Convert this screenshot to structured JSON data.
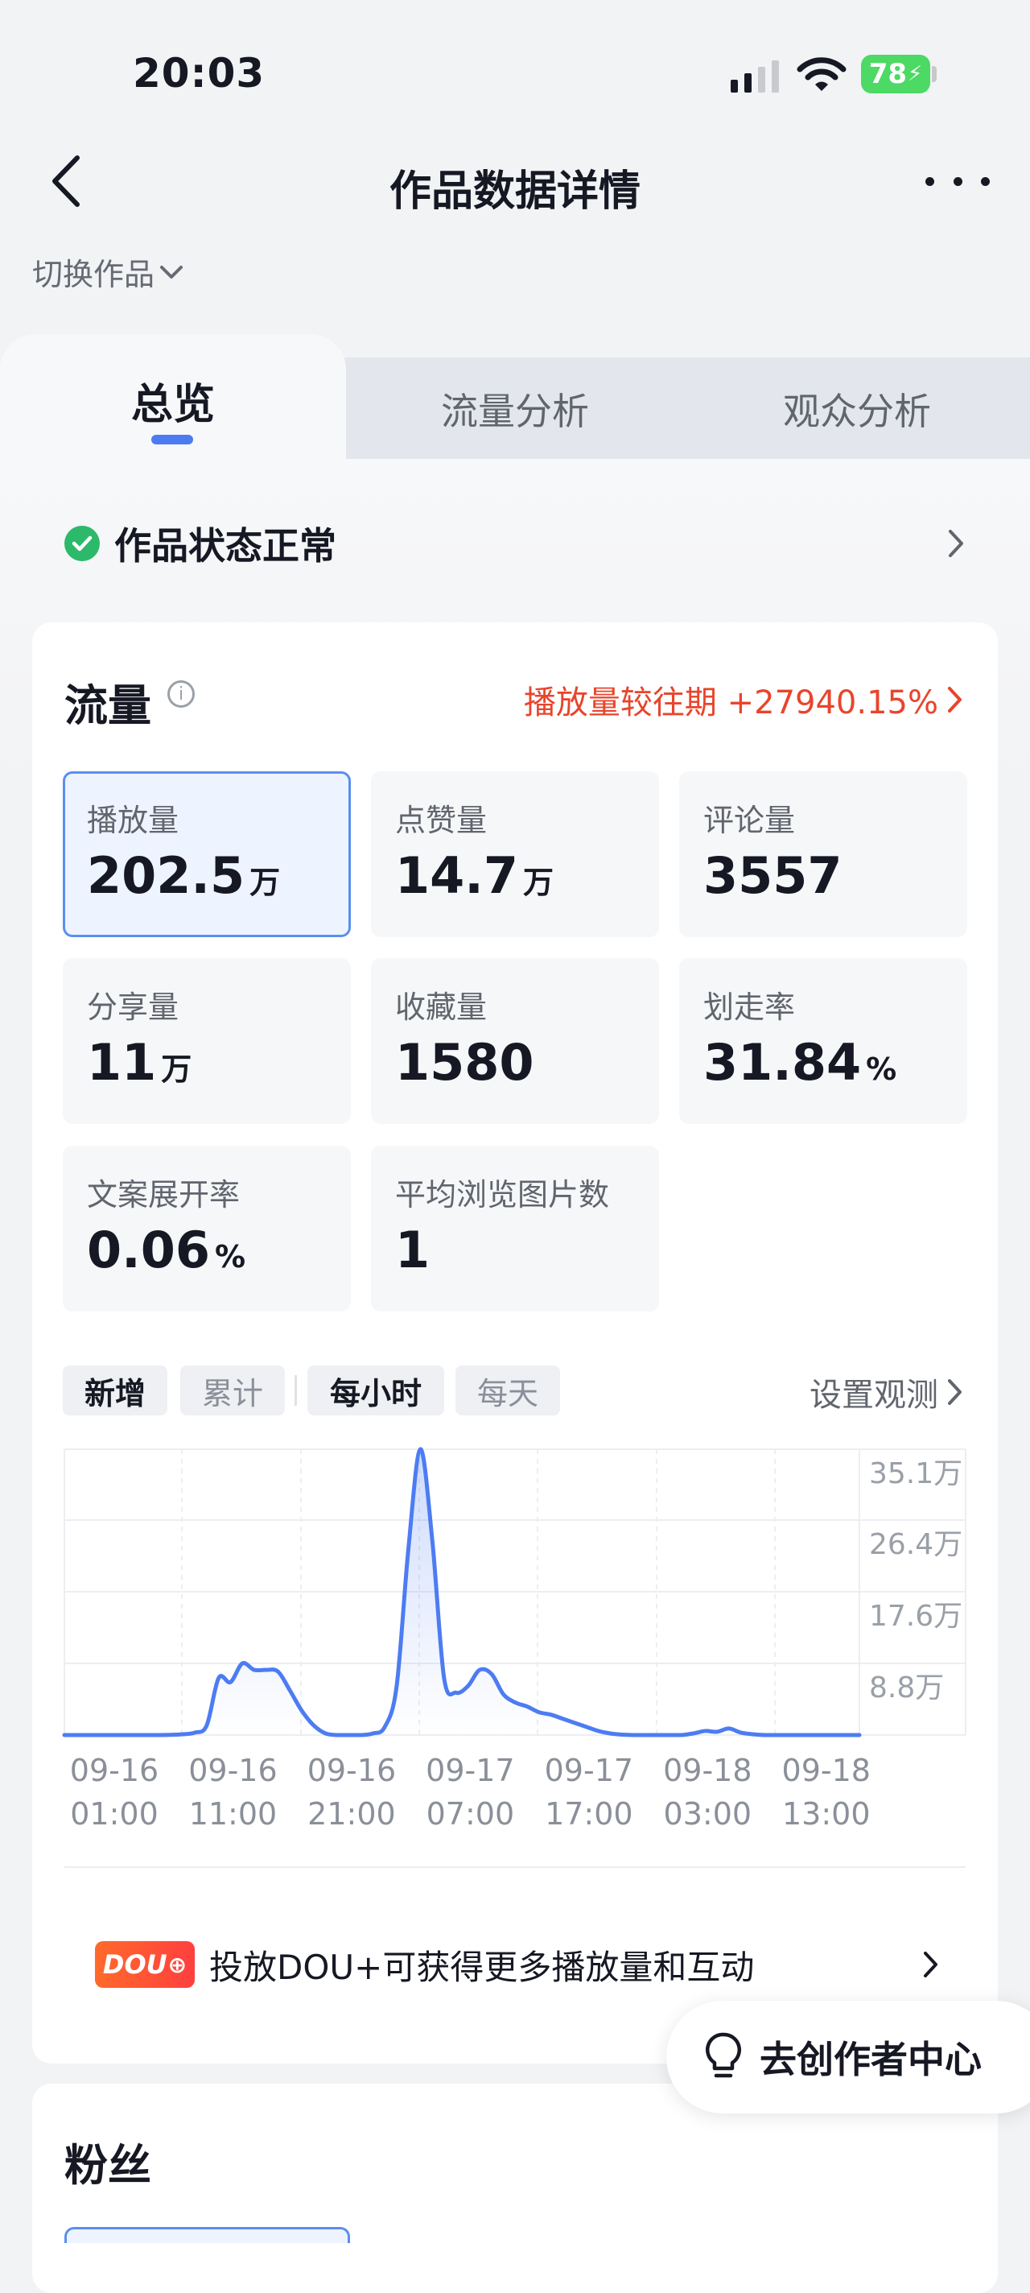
{
  "status_bar": {
    "time": "20:03",
    "battery": "78"
  },
  "header": {
    "title": "作品数据详情",
    "switch_label": "切换作品"
  },
  "tabs": [
    {
      "label": "总览",
      "active": true
    },
    {
      "label": "流量分析",
      "active": false
    },
    {
      "label": "观众分析",
      "active": false
    }
  ],
  "status": {
    "text": "作品状态正常"
  },
  "traffic": {
    "title": "流量",
    "compare_text": "播放量较往期 +27940.15%",
    "metrics": [
      {
        "label": "播放量",
        "value": "202.5",
        "unit": "万",
        "selected": true
      },
      {
        "label": "点赞量",
        "value": "14.7",
        "unit": "万"
      },
      {
        "label": "评论量",
        "value": "3557",
        "unit": ""
      },
      {
        "label": "分享量",
        "value": "11",
        "unit": "万"
      },
      {
        "label": "收藏量",
        "value": "1580",
        "unit": ""
      },
      {
        "label": "划走率",
        "value": "31.84",
        "unit": "%"
      },
      {
        "label": "文案展开率",
        "value": "0.06",
        "unit": "%"
      },
      {
        "label": "平均浏览图片数",
        "value": "1",
        "unit": ""
      }
    ],
    "chips": [
      {
        "label": "新增",
        "active": true
      },
      {
        "label": "累计",
        "active": false
      },
      {
        "label": "每小时",
        "active": true
      },
      {
        "label": "每天",
        "active": false
      }
    ],
    "observe_label": "设置观测"
  },
  "chart_data": {
    "type": "line",
    "y_tick_labels": [
      "35.1万",
      "26.4万",
      "17.6万",
      "8.8万"
    ],
    "y_ticks": [
      351000,
      264000,
      176000,
      88000
    ],
    "ylim": [
      0,
      351000
    ],
    "x_tick_labels": [
      [
        "09-16",
        "01:00"
      ],
      [
        "09-16",
        "11:00"
      ],
      [
        "09-16",
        "21:00"
      ],
      [
        "09-17",
        "07:00"
      ],
      [
        "09-17",
        "17:00"
      ],
      [
        "09-18",
        "03:00"
      ],
      [
        "09-18",
        "13:00"
      ]
    ],
    "x_tick_hours": [
      0,
      10,
      20,
      30,
      40,
      50,
      60
    ],
    "xlim": [
      0,
      67
    ],
    "grid": true,
    "series": [
      {
        "color": "#4d7cf2",
        "x": [
          0,
          2,
          4,
          6,
          8,
          10,
          11,
          12,
          13,
          14,
          15,
          16,
          17,
          18,
          19,
          20,
          21,
          22,
          23,
          24,
          25,
          26,
          27,
          28,
          29,
          30,
          31,
          32,
          33,
          34,
          35,
          36,
          37,
          38,
          39,
          40,
          41,
          42,
          43,
          44,
          45,
          46,
          47,
          48,
          49,
          50,
          51,
          52,
          53,
          54,
          55,
          56,
          57,
          58,
          59,
          60,
          61,
          62,
          63,
          64,
          65,
          66,
          67
        ],
        "y": [
          0,
          0,
          0,
          0,
          0,
          1000,
          3000,
          12000,
          70000,
          65000,
          88000,
          80000,
          80000,
          78000,
          55000,
          30000,
          12000,
          2000,
          0,
          0,
          0,
          2000,
          10000,
          60000,
          230000,
          351000,
          240000,
          70000,
          52000,
          60000,
          80000,
          75000,
          50000,
          40000,
          35000,
          28000,
          25000,
          20000,
          15000,
          10000,
          5000,
          2000,
          500,
          0,
          0,
          0,
          0,
          0,
          2000,
          5000,
          4000,
          8000,
          3000,
          1000,
          0,
          0,
          0,
          0,
          0,
          0,
          0,
          0,
          0
        ]
      }
    ]
  },
  "dou_promo": {
    "logo": "DOU",
    "text": "投放DOU+可获得更多播放量和互动"
  },
  "float_button": {
    "label": "去创作者中心"
  },
  "fans": {
    "title": "粉丝"
  }
}
